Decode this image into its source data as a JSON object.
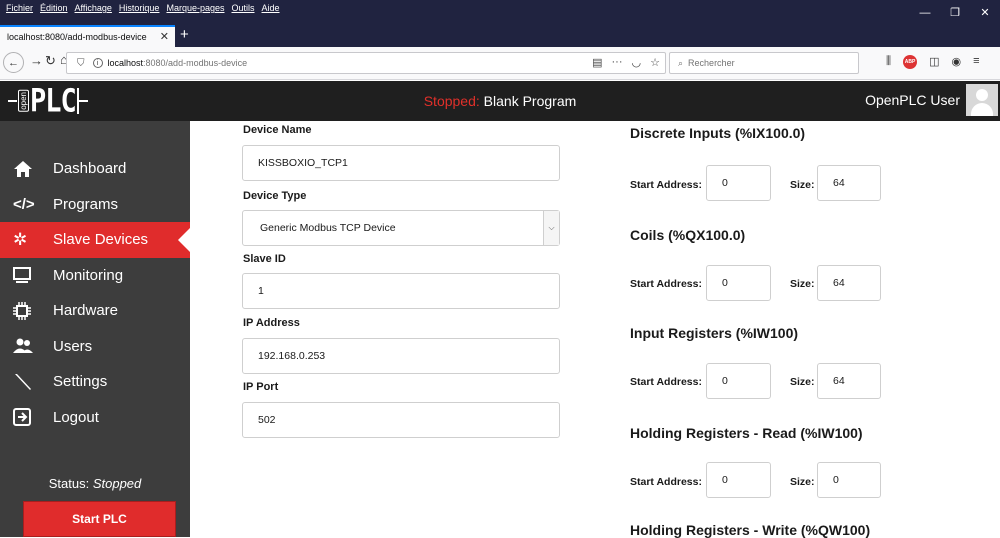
{
  "browser": {
    "menu": [
      "Fichier",
      "Édition",
      "Affichage",
      "Historique",
      "Marque-pages",
      "Outils",
      "Aide"
    ],
    "tab_title": "localhost:8080/add-modbus-device",
    "url_host": "localhost",
    "url_path": ":8080/add-modbus-device",
    "search_placeholder": "Rechercher"
  },
  "header": {
    "logo_small": "open",
    "logo_text": "PLC",
    "status_prefix": "Stopped:",
    "program_name": "Blank Program",
    "user_name": "OpenPLC User"
  },
  "sidebar": {
    "items": [
      {
        "label": "Dashboard",
        "icon": "home-icon"
      },
      {
        "label": "Programs",
        "icon": "code-icon"
      },
      {
        "label": "Slave Devices",
        "icon": "gear-cluster-icon",
        "active": true
      },
      {
        "label": "Monitoring",
        "icon": "monitor-icon"
      },
      {
        "label": "Hardware",
        "icon": "chip-icon"
      },
      {
        "label": "Users",
        "icon": "users-icon"
      },
      {
        "label": "Settings",
        "icon": "wrench-icon"
      },
      {
        "label": "Logout",
        "icon": "logout-icon"
      }
    ],
    "status_label": "Status:",
    "status_value": "Stopped",
    "start_button": "Start PLC"
  },
  "form": {
    "device_name_label": "Device Name",
    "device_name": "KISSBOXIO_TCP1",
    "device_type_label": "Device Type",
    "device_type": "Generic Modbus TCP Device",
    "slave_id_label": "Slave ID",
    "slave_id": "1",
    "ip_address_label": "IP Address",
    "ip_address": "192.168.0.253",
    "ip_port_label": "IP Port",
    "ip_port": "502"
  },
  "registers": {
    "start_label": "Start Address:",
    "size_label": "Size:",
    "discrete_inputs": {
      "title": "Discrete Inputs (%IX100.0)",
      "start": "0",
      "size": "64"
    },
    "coils": {
      "title": "Coils (%QX100.0)",
      "start": "0",
      "size": "64"
    },
    "input_registers": {
      "title": "Input Registers (%IW100)",
      "start": "0",
      "size": "64"
    },
    "holding_read": {
      "title": "Holding Registers - Read (%IW100)",
      "start": "0",
      "size": "0"
    },
    "holding_write": {
      "title": "Holding Registers - Write (%QW100)"
    }
  }
}
